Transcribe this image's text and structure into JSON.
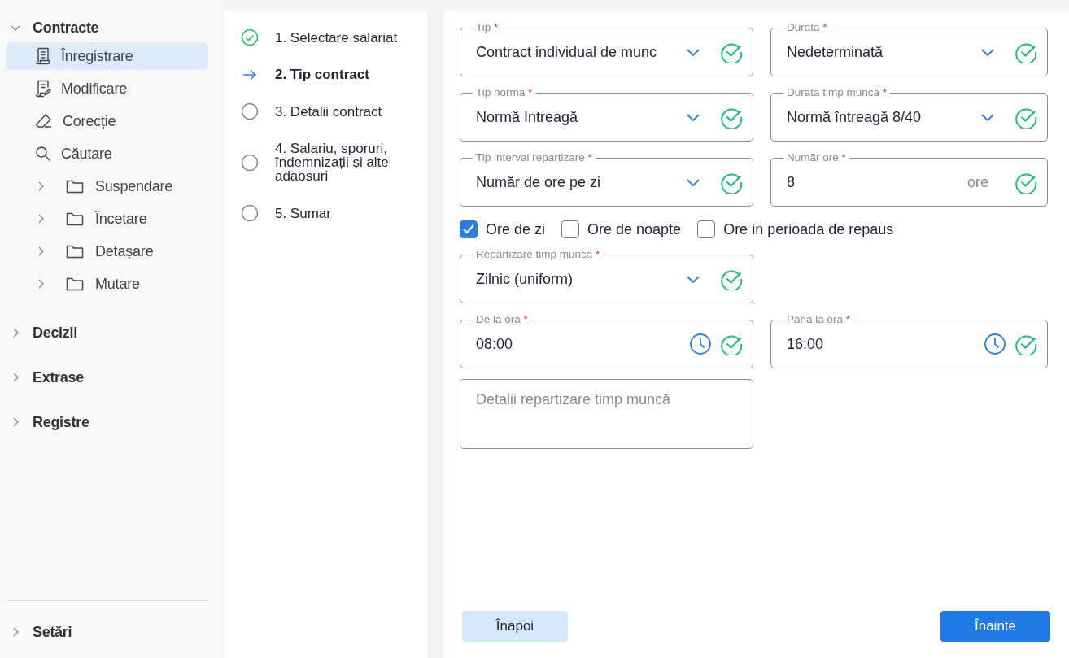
{
  "sidebar": {
    "sections": [
      {
        "label": "Contracte",
        "expanded": true,
        "items": [
          {
            "kind": "page",
            "label": "Înregistrare",
            "selected": true
          },
          {
            "kind": "page",
            "label": "Modificare",
            "selected": false
          },
          {
            "kind": "page",
            "label": "Corecție",
            "selected": false
          },
          {
            "kind": "page",
            "label": "Căutare",
            "selected": false
          },
          {
            "kind": "folder",
            "label": "Suspendare",
            "selected": false
          },
          {
            "kind": "folder",
            "label": "Încetare",
            "selected": false
          },
          {
            "kind": "folder",
            "label": "Detașare",
            "selected": false
          },
          {
            "kind": "folder",
            "label": "Mutare",
            "selected": false
          }
        ]
      },
      {
        "label": "Decizii",
        "expanded": false
      },
      {
        "label": "Extrase",
        "expanded": false
      },
      {
        "label": "Registre",
        "expanded": false
      }
    ],
    "footer": {
      "label": "Setări",
      "expanded": false
    }
  },
  "steps": [
    {
      "label": "1. Selectare salariat",
      "kind": "done"
    },
    {
      "label": "2. Tip contract",
      "kind": "current"
    },
    {
      "label": "3. Detalii contract",
      "kind": "pending"
    },
    {
      "label": "4. Salariu, sporuri, îndemnizații și alte adaosuri",
      "kind": "pending"
    },
    {
      "label": "5. Sumar",
      "kind": "pending"
    }
  ],
  "form": [
    {
      "kind": "fields",
      "fields": [
        {
          "kind": "select",
          "label": "Tip",
          "required_mark": "*",
          "value": "Contract individual de munc",
          "valid": true
        },
        {
          "kind": "select",
          "label": "Durată",
          "required_mark": "*",
          "value": "Nedeterminată",
          "valid": true
        }
      ]
    },
    {
      "kind": "fields",
      "fields": [
        {
          "kind": "select",
          "label": "Tip normă",
          "required_mark": "*",
          "value": "Normă Intreagă",
          "valid": true
        },
        {
          "kind": "select",
          "label": "Durată timp muncă",
          "required_mark": "*",
          "value": "Normă întreagă 8/40",
          "valid": true
        }
      ]
    },
    {
      "kind": "fields",
      "fields": [
        {
          "kind": "select",
          "label": "Tip interval repartizare",
          "required_mark": "*",
          "value": "Număr de ore pe zi",
          "valid": true
        },
        {
          "kind": "number",
          "label": "Număr ore",
          "required_mark": "*",
          "value": "8",
          "suffix": "ore",
          "valid": true
        }
      ]
    },
    {
      "kind": "checkboxes",
      "items": [
        {
          "label": "Ore de zi",
          "checked": true
        },
        {
          "label": "Ore de noapte",
          "checked": false
        },
        {
          "label": "Ore in perioada de repaus",
          "checked": false
        }
      ]
    },
    {
      "kind": "fields",
      "fields": [
        {
          "kind": "select",
          "label": "Repartizare timp muncă",
          "required_mark": "*",
          "value": "Zilnic (uniform)",
          "valid": true
        }
      ]
    },
    {
      "kind": "fields",
      "fields": [
        {
          "kind": "time",
          "label": "De la ora",
          "required_mark": "*",
          "value": "08:00",
          "valid": true
        },
        {
          "kind": "time",
          "label": "Până la ora",
          "required_mark": "*",
          "value": "16:00",
          "valid": true
        }
      ]
    },
    {
      "kind": "fields",
      "fields": [
        {
          "kind": "textarea",
          "placeholder": "Detalii repartizare timp muncă"
        }
      ]
    }
  ],
  "buttons": [
    {
      "kind": "secondary",
      "label": "Înapoi"
    },
    {
      "kind": "primary",
      "label": "Înainte"
    }
  ]
}
